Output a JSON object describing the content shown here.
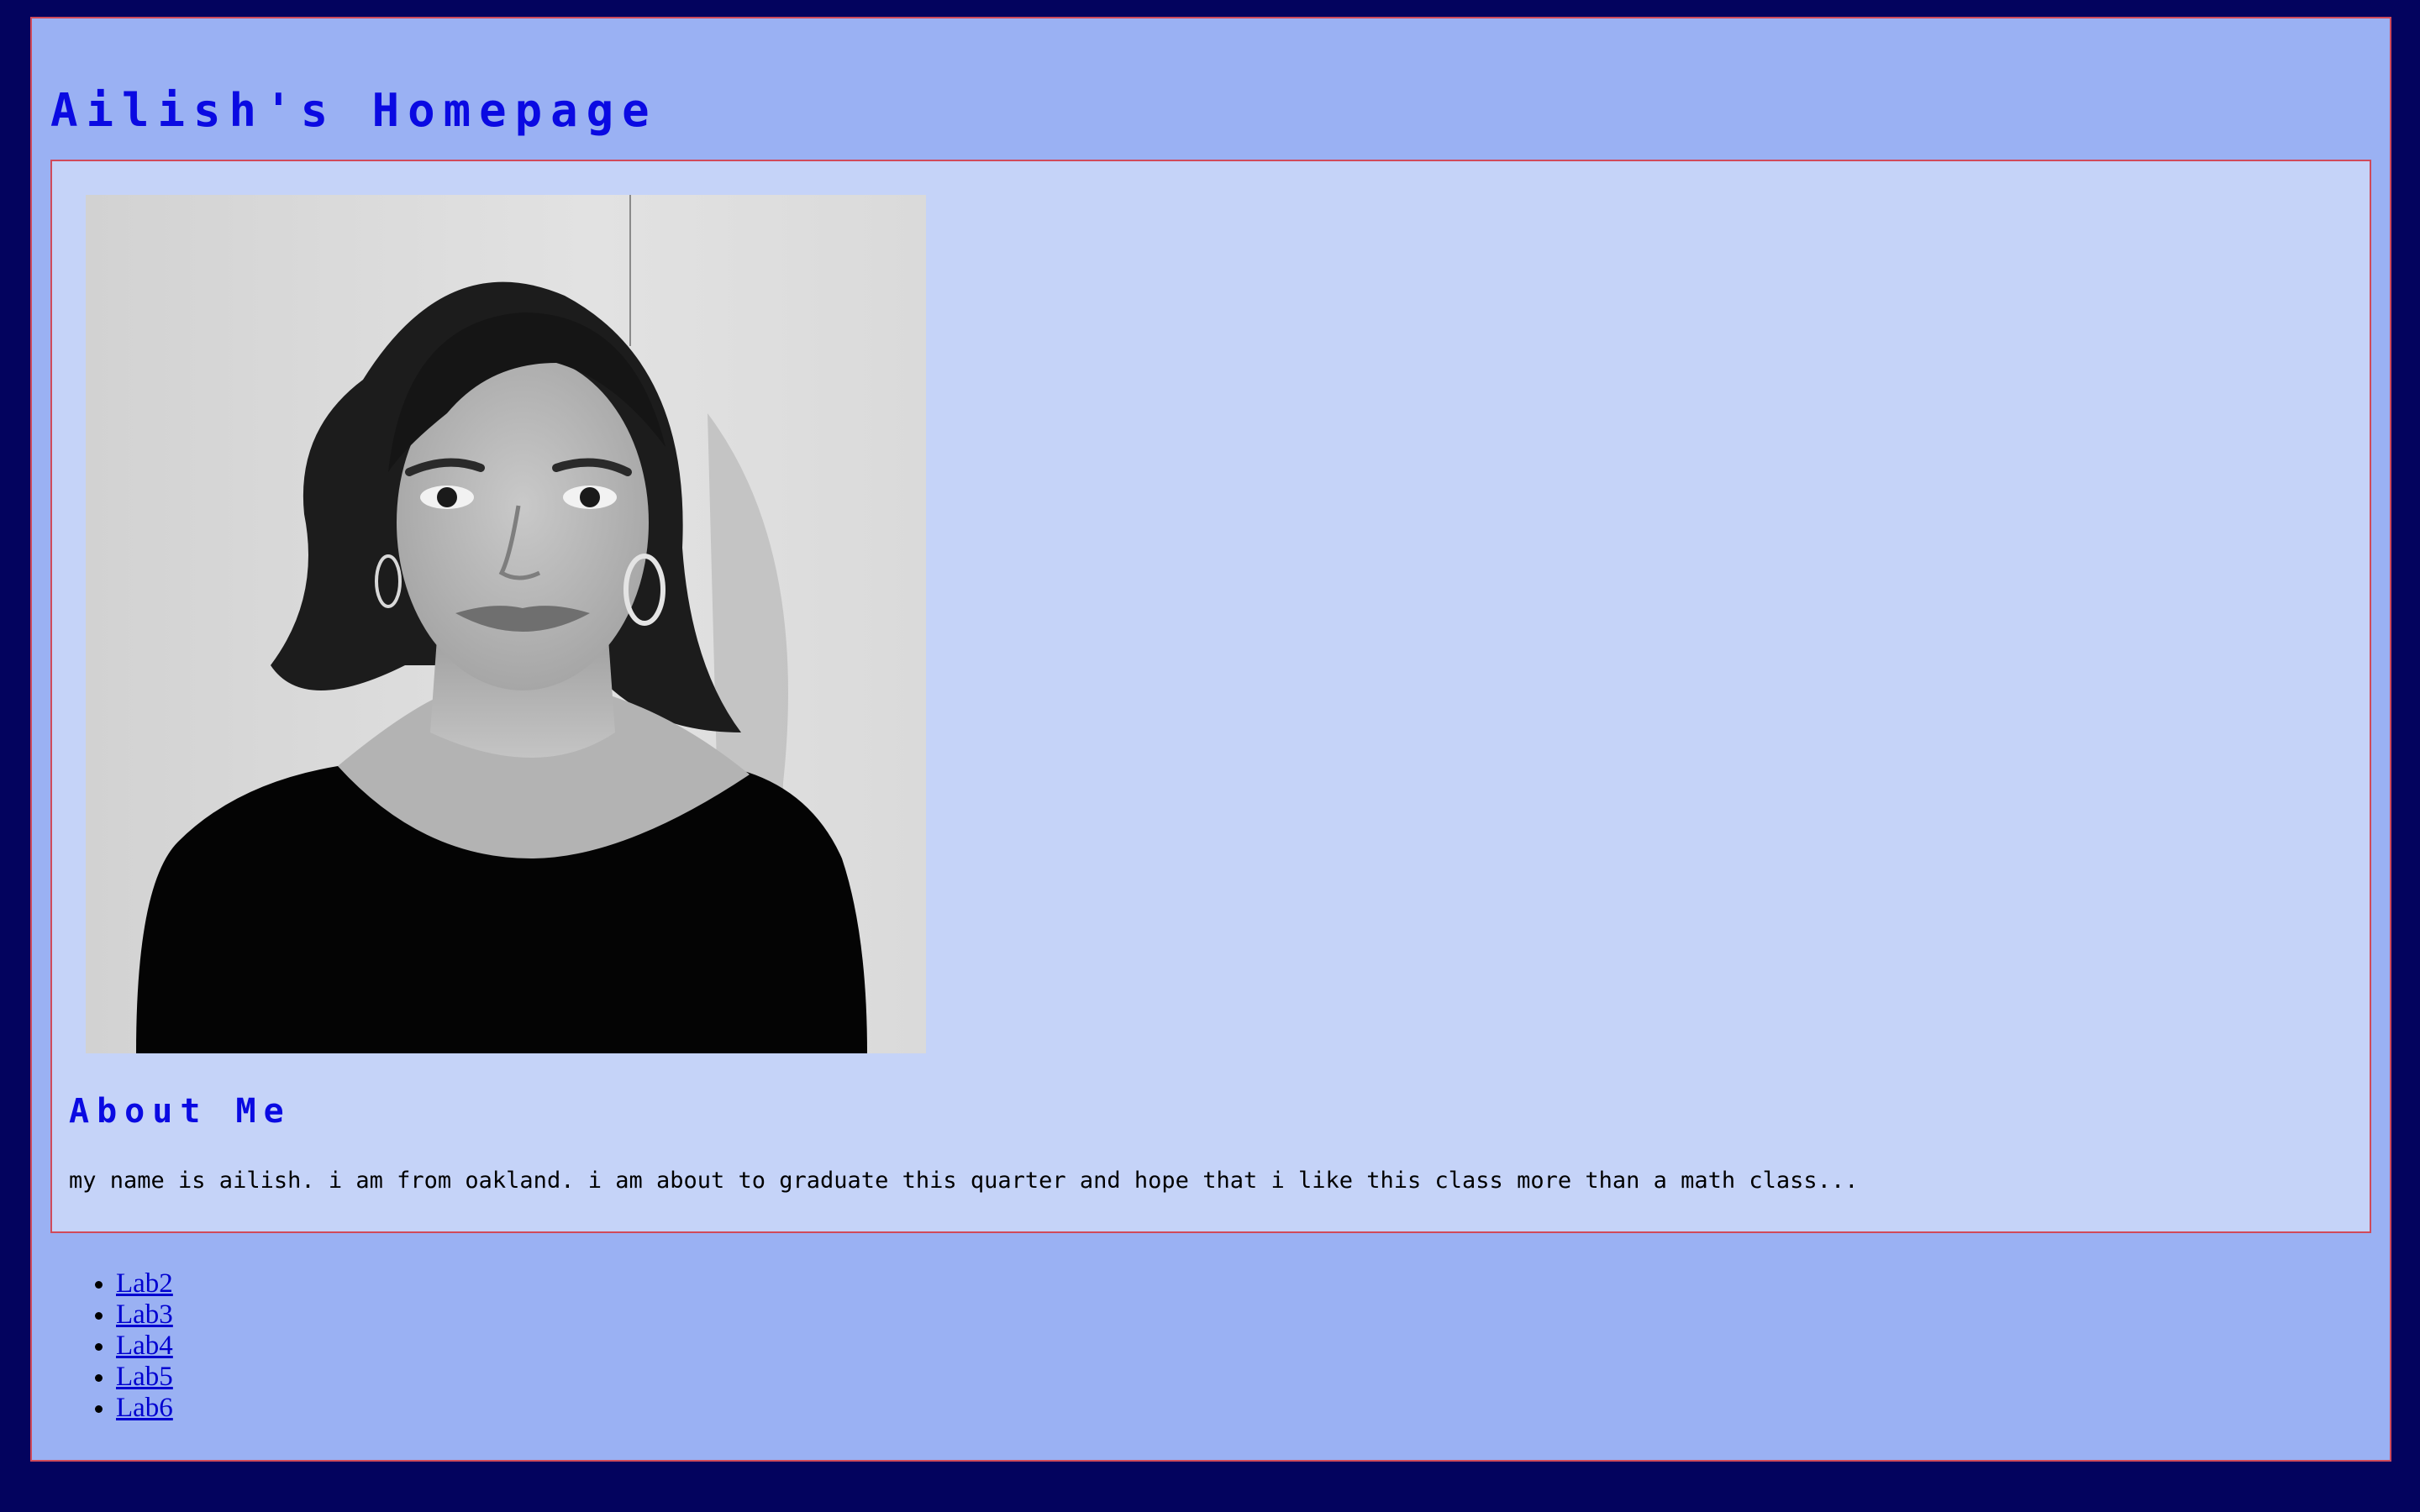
{
  "page": {
    "title": "Ailish's Homepage"
  },
  "profile": {
    "image_alt": "portrait photo"
  },
  "about": {
    "heading": "About Me",
    "text": "my name is ailish. i am from oakland. i am about to graduate this quarter and hope that i like this class more than a math class..."
  },
  "links": [
    {
      "label": "Lab2"
    },
    {
      "label": "Lab3"
    },
    {
      "label": "Lab4"
    },
    {
      "label": "Lab5"
    },
    {
      "label": "Lab6"
    }
  ],
  "colors": {
    "page_background": "#03035e",
    "outer_panel": "#9ab1f3",
    "inner_panel": "#c5d3f8",
    "border": "#d04a5a",
    "heading": "#0a0ae2",
    "link": "#0000d0"
  }
}
